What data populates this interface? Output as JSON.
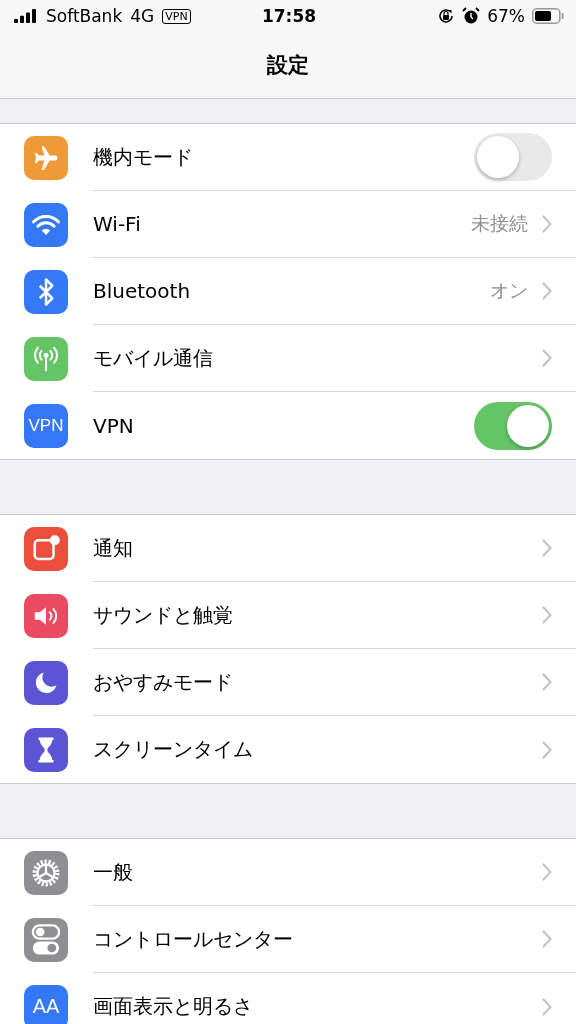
{
  "status_bar": {
    "carrier": "SoftBank",
    "network": "4G",
    "vpn_badge": "VPN",
    "time": "17:58",
    "battery": "67%"
  },
  "nav": {
    "title": "設定"
  },
  "sections": [
    {
      "rows": [
        {
          "color": "#f09a37",
          "label": "機内モード",
          "kind": "toggle",
          "on": false
        },
        {
          "color": "#3478f6",
          "label": "Wi-Fi",
          "kind": "link",
          "value": "未接続"
        },
        {
          "color": "#3478f6",
          "label": "Bluetooth",
          "kind": "link",
          "value": "オン"
        },
        {
          "color": "#65c466",
          "label": "モバイル通信",
          "kind": "link"
        },
        {
          "icon_text": "VPN",
          "color": "#3478f6",
          "label": "VPN",
          "kind": "toggle",
          "on": true
        }
      ]
    },
    {
      "rows": [
        {
          "color": "#eb4e3d",
          "label": "通知",
          "kind": "link"
        },
        {
          "color": "#eb4b62",
          "label": "サウンドと触覚",
          "kind": "link"
        },
        {
          "color": "#5b55d6",
          "label": "おやすみモード",
          "kind": "link"
        },
        {
          "color": "#5b55d6",
          "label": "スクリーンタイム",
          "kind": "link"
        }
      ]
    },
    {
      "rows": [
        {
          "color": "#8e8e93",
          "label": "一般",
          "kind": "link"
        },
        {
          "color": "#8e8e93",
          "label": "コントロールセンター",
          "kind": "link"
        },
        {
          "icon_text": "AA",
          "color": "#3478f6",
          "label": "画面表示と明るさ",
          "kind": "link"
        }
      ]
    }
  ]
}
